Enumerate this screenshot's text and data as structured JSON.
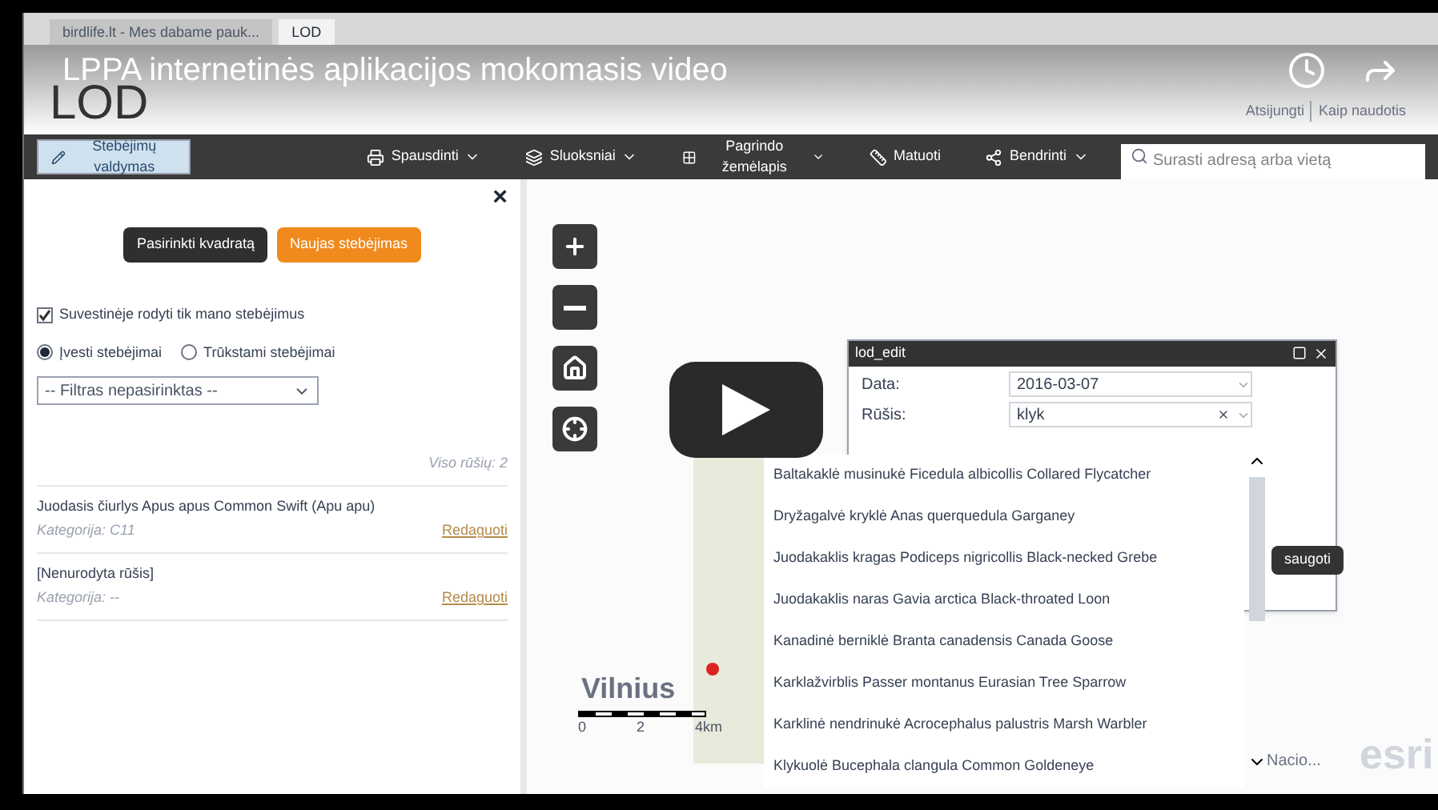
{
  "browser_tabs": [
    {
      "label": "birdlife.lt - Mes dabame pauk...",
      "selected": false
    },
    {
      "label": "LOD",
      "selected": true
    }
  ],
  "video": {
    "title": "LPPA internetinės aplikacijos mokomasis video"
  },
  "app": {
    "logo": "LOD",
    "user_links": [
      "Atsijungti",
      "Kaip naudotis"
    ]
  },
  "toolbar": {
    "items": [
      {
        "label": "Stebėjimų valdymas",
        "selected": true,
        "caret": false
      },
      {
        "label": "Spausdinti",
        "selected": false,
        "caret": true
      },
      {
        "label": "Sluoksniai",
        "selected": false,
        "caret": true
      },
      {
        "label": "Pagrindo žemėlapis",
        "selected": false,
        "caret": true
      },
      {
        "label": "Matuoti",
        "selected": false,
        "caret": false
      },
      {
        "label": "Bendrinti",
        "selected": false,
        "caret": true
      }
    ],
    "search": {
      "placeholder": "Surasti adresą arba vietą"
    }
  },
  "panel": {
    "close": "×",
    "buttons": [
      {
        "label": "Pasirinkti kvadratą",
        "kind": "dark"
      },
      {
        "label": "Naujas stebėjimas",
        "kind": "orange"
      }
    ],
    "checkbox": {
      "label": "Suvestinėje rodyti tik mano stebėjimus",
      "checked": true
    },
    "radios": [
      {
        "label": "Įvesti stebėjimai",
        "selected": true
      },
      {
        "label": "Trūkstami stebėjimai",
        "selected": false
      }
    ],
    "filter": {
      "value": "-- Filtras nepasirinktas --"
    },
    "total": "Viso rūšių: 2",
    "records": [
      {
        "name": "Juodasis čiurlys Apus apus Common Swift (Apu apu)",
        "category": "Kategorija: C11",
        "action": "Redaguoti"
      },
      {
        "name": "[Nenurodyta rūšis]",
        "category": "Kategorija: --",
        "action": "Redaguoti"
      }
    ]
  },
  "map": {
    "city": "Vilnius",
    "scale": [
      "0",
      "2",
      "4km"
    ],
    "attribution": "Nacio...",
    "logo": "esri"
  },
  "dialog": {
    "title": "lod_edit",
    "fields": [
      {
        "label": "Data:",
        "value": "2016-03-07",
        "clear": false
      },
      {
        "label": "Rūšis:",
        "value": "klyk",
        "clear": true
      }
    ],
    "save": "saugoti",
    "suggestions": [
      "Baltakaklė musinukė Ficedula albicollis Collared Flycatcher",
      "Dryžagalvė kryklė Anas querquedula Garganey",
      "Juodakaklis kragas Podiceps nigricollis Black-necked Grebe",
      "Juodakaklis naras Gavia arctica Black-throated Loon",
      "Kanadinė berniklė Branta canadensis Canada Goose",
      "Karklažvirblis Passer montanus Eurasian Tree Sparrow",
      "Karklinė nendrinukė Acrocephalus palustris Marsh Warbler",
      "Klykuolė Bucephala clangula Common Goldeneye"
    ]
  }
}
